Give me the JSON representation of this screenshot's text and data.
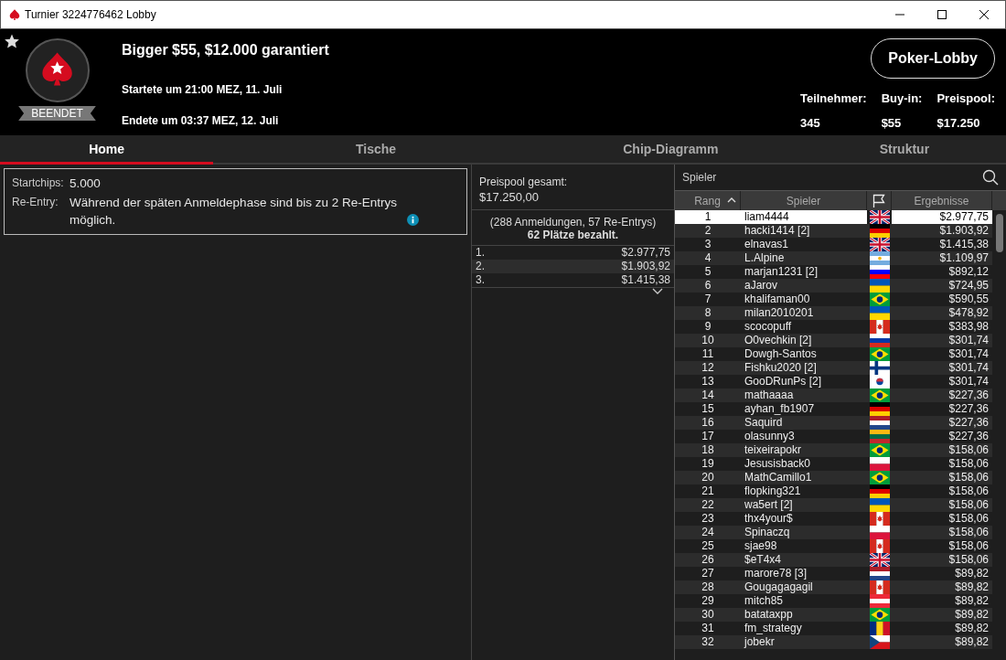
{
  "window": {
    "title": "Turnier 3224776462 Lobby"
  },
  "header": {
    "status": "BEENDET",
    "title": "Bigger $55, $12.000 garantiert",
    "started": "Startete um 21:00 MEZ, 11. Juli",
    "ended": "Endete um 03:37 MEZ, 12. Juli",
    "button": "Poker-Lobby",
    "stats": [
      {
        "label": "Teilnehmer:",
        "value": "345"
      },
      {
        "label": "Buy-in:",
        "value": "$55"
      },
      {
        "label": "Preispool:",
        "value": "$17.250"
      }
    ]
  },
  "tabs": [
    {
      "label": "Home",
      "selected": true
    },
    {
      "label": "Tische",
      "selected": false
    },
    {
      "label": "Chip-Diagramm",
      "selected": false
    },
    {
      "label": "Struktur",
      "selected": false
    }
  ],
  "info": [
    {
      "label": "Startchips:",
      "value": "5.000",
      "info": false
    },
    {
      "label": "Re-Entry:",
      "value": "Während der späten Anmeldephase sind bis zu 2 Re-Entrys möglich.",
      "info": true
    }
  ],
  "prizepool": {
    "label": "Preispool gesamt:",
    "total": "$17.250,00",
    "entries": "(288 Anmeldungen, 57 Re-Entrys)",
    "paid": "62 Plätze bezahlt.",
    "payouts": [
      {
        "place": "1.",
        "amount": "$2.977,75"
      },
      {
        "place": "2.",
        "amount": "$1.903,92"
      },
      {
        "place": "3.",
        "amount": "$1.415,38"
      }
    ]
  },
  "players": {
    "search_placeholder": "Spieler",
    "columns": [
      {
        "kind": "text",
        "label": "Rang",
        "sorted": true
      },
      {
        "kind": "text",
        "label": "Spieler",
        "sorted": false
      },
      {
        "kind": "flag",
        "sorted": false
      },
      {
        "kind": "text",
        "label": "Ergebnisse",
        "sorted": false
      }
    ],
    "rows": [
      {
        "rank": "1",
        "name": "liam4444",
        "kind": "gb",
        "result": "$2.977,75",
        "selected": true
      },
      {
        "rank": "2",
        "name": "hacki1414 [2]",
        "kind": "de",
        "result": "$1.903,92",
        "selected": false
      },
      {
        "rank": "3",
        "name": "elnavas1",
        "kind": "gb",
        "result": "$1.415,38",
        "selected": false
      },
      {
        "rank": "4",
        "name": "L.Alpine",
        "kind": "ar",
        "result": "$1.109,97",
        "selected": false
      },
      {
        "rank": "5",
        "name": "marjan1231 [2]",
        "kind": "si",
        "result": "$892,12",
        "selected": false
      },
      {
        "rank": "6",
        "name": "aJarov",
        "kind": "ua",
        "result": "$724,95",
        "selected": false
      },
      {
        "rank": "7",
        "name": "khalifaman00",
        "kind": "br",
        "result": "$590,55",
        "selected": false
      },
      {
        "rank": "8",
        "name": "milan2010201",
        "kind": "ua",
        "result": "$478,92",
        "selected": false
      },
      {
        "rank": "9",
        "name": "scocopuff",
        "kind": "ca",
        "result": "$383,98",
        "selected": false
      },
      {
        "rank": "10",
        "name": "O0vechkin [2]",
        "kind": "ru",
        "result": "$301,74",
        "selected": false
      },
      {
        "rank": "11",
        "name": "Dowgh-Santos",
        "kind": "br",
        "result": "$301,74",
        "selected": false
      },
      {
        "rank": "12",
        "name": "Fishku2020 [2]",
        "kind": "fi",
        "result": "$301,74",
        "selected": false
      },
      {
        "rank": "13",
        "name": "GooDRunPs [2]",
        "kind": "kr",
        "result": "$301,74",
        "selected": false
      },
      {
        "rank": "14",
        "name": "mathaaaa",
        "kind": "br",
        "result": "$227,36",
        "selected": false
      },
      {
        "rank": "15",
        "name": "ayhan_fb1907",
        "kind": "de",
        "result": "$227,36",
        "selected": false
      },
      {
        "rank": "16",
        "name": "Saquird",
        "kind": "nl",
        "result": "$227,36",
        "selected": false
      },
      {
        "rank": "17",
        "name": "olasunny3",
        "kind": "lt",
        "result": "$227,36",
        "selected": false
      },
      {
        "rank": "18",
        "name": "teixeirapokr",
        "kind": "br",
        "result": "$158,06",
        "selected": false
      },
      {
        "rank": "19",
        "name": "Jesusisback0",
        "kind": "pl",
        "result": "$158,06",
        "selected": false
      },
      {
        "rank": "20",
        "name": "MathCamillo1",
        "kind": "br",
        "result": "$158,06",
        "selected": false
      },
      {
        "rank": "21",
        "name": "flopking321",
        "kind": "de",
        "result": "$158,06",
        "selected": false
      },
      {
        "rank": "22",
        "name": "wa5ert [2]",
        "kind": "ua",
        "result": "$158,06",
        "selected": false
      },
      {
        "rank": "23",
        "name": "thx4your$",
        "kind": "ca",
        "result": "$158,06",
        "selected": false
      },
      {
        "rank": "24",
        "name": "Spinaczq",
        "kind": "pl",
        "result": "$158,06",
        "selected": false
      },
      {
        "rank": "25",
        "name": "sjae98",
        "kind": "ca",
        "result": "$158,06",
        "selected": false
      },
      {
        "rank": "26",
        "name": "$eT4x4",
        "kind": "gb",
        "result": "$158,06",
        "selected": false
      },
      {
        "rank": "27",
        "name": "marore78 [3]",
        "kind": "nl",
        "result": "$89,82",
        "selected": false
      },
      {
        "rank": "28",
        "name": "Gougagagagil",
        "kind": "ca",
        "result": "$89,82",
        "selected": false
      },
      {
        "rank": "29",
        "name": "mitch85",
        "kind": "at",
        "result": "$89,82",
        "selected": false
      },
      {
        "rank": "30",
        "name": "batataxpp",
        "kind": "br",
        "result": "$89,82",
        "selected": false
      },
      {
        "rank": "31",
        "name": "fm_strategy",
        "kind": "ro",
        "result": "$89,82",
        "selected": false
      },
      {
        "rank": "32",
        "name": "jobekr",
        "kind": "cz",
        "result": "$89,82",
        "selected": false
      }
    ]
  }
}
